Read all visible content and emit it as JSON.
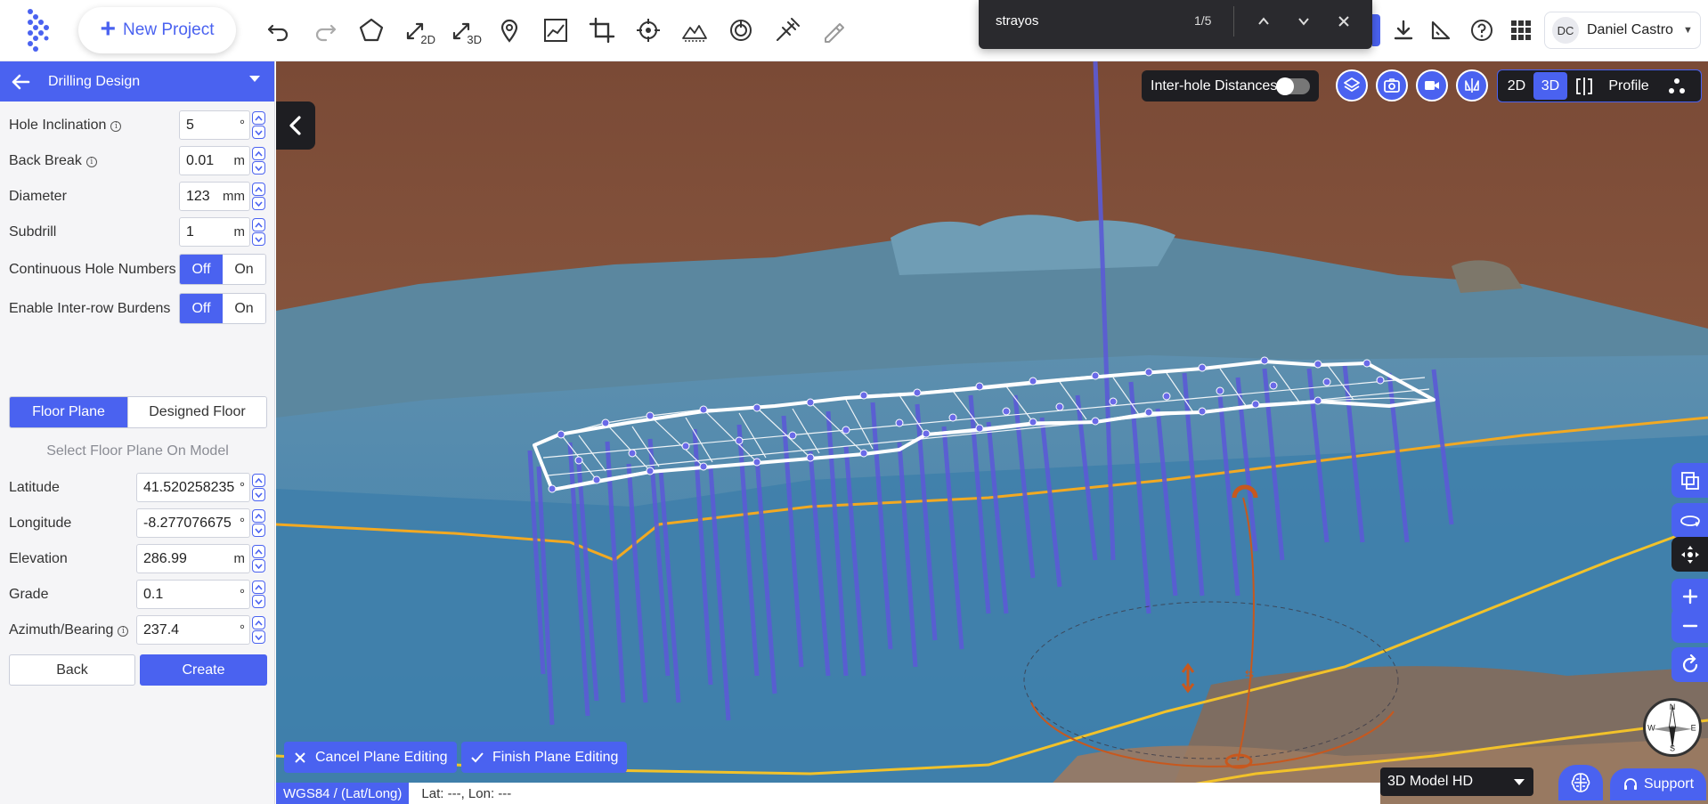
{
  "topbar": {
    "new_project_label": "New Project",
    "tools": [
      "undo-icon",
      "redo-icon",
      "polygon-icon",
      "measure-2d-icon",
      "measure-3d-icon",
      "pin-icon",
      "profile-chart-icon",
      "crop-icon",
      "target-icon",
      "terrain-icon",
      "gps-icon",
      "drill-icon",
      "pen-icon"
    ],
    "tool_2d_sub": "2D",
    "tool_3d_sub": "3D",
    "right_icons": [
      "download-icon",
      "ruler-icon",
      "help-icon",
      "apps-grid-icon"
    ],
    "user": {
      "initials": "DC",
      "name": "Daniel Castro"
    }
  },
  "findbar": {
    "query": "strayos",
    "count": "1/5"
  },
  "panel": {
    "title": "Drilling Design",
    "fields": [
      {
        "label": "Hole Inclination",
        "info": true,
        "value": "5",
        "unit": "°"
      },
      {
        "label": "Back Break",
        "info": true,
        "value": "0.01",
        "unit": "m"
      },
      {
        "label": "Diameter",
        "info": false,
        "value": "123",
        "unit": "mm"
      },
      {
        "label": "Subdrill",
        "info": false,
        "value": "1",
        "unit": "m"
      }
    ],
    "toggles": [
      {
        "label": "Continuous Hole Numbers",
        "off": "Off",
        "on": "On",
        "selected": "Off"
      },
      {
        "label": "Enable Inter-row Burdens",
        "off": "Off",
        "on": "On",
        "selected": "Off"
      }
    ],
    "floor_tabs": {
      "floor_plane": "Floor Plane",
      "designed_floor": "Designed Floor",
      "selected": "Floor Plane"
    },
    "select_floor_hint": "Select Floor Plane On Model",
    "coord_fields": [
      {
        "label": "Latitude",
        "info": false,
        "value": "41.520258235",
        "unit": "°"
      },
      {
        "label": "Longitude",
        "info": false,
        "value": "-8.277076675",
        "unit": "°"
      },
      {
        "label": "Elevation",
        "info": false,
        "value": "286.99",
        "unit": "m"
      },
      {
        "label": "Grade",
        "info": false,
        "value": "0.1",
        "unit": "°"
      },
      {
        "label": "Azimuth/Bearing",
        "info": true,
        "value": "237.4",
        "unit": "°"
      }
    ],
    "back_label": "Back",
    "create_label": "Create"
  },
  "viewport": {
    "interhole_label": "Inter-hole Distances",
    "interhole_enabled": false,
    "view_modes": {
      "d2": "2D",
      "d3": "3D",
      "profile": "Profile",
      "active": "3D"
    },
    "cancel_label": "Cancel Plane Editing",
    "finish_label": "Finish Plane Editing",
    "model_select": "3D Model HD",
    "support_label": "Support",
    "crs_label": "WGS84 / (Lat/Long)",
    "coords_label": "Lat: ---, Lon: ---",
    "compass": {
      "n": "N",
      "s": "S",
      "e": "E",
      "w": "W"
    }
  },
  "colors": {
    "accent": "#4a62f0",
    "dark": "#1e1e22",
    "terrain_water": "#4a8fb5",
    "terrain_ground": "#8a5a42",
    "contour": "#f2a922",
    "hole": "#5b5bd6"
  }
}
